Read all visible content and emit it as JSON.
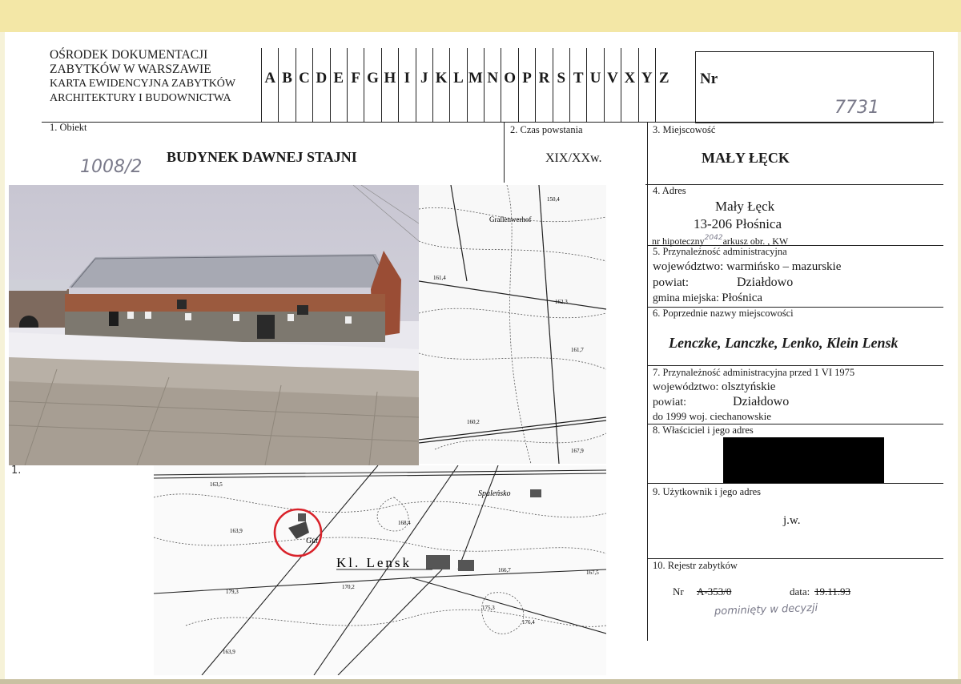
{
  "header": {
    "org_line1": "OŚRODEK DOKUMENTACJI",
    "org_line2": "ZABYTKÓW W WARSZAWIE",
    "org_line3": "KARTA EWIDENCYJNA ZABYTKÓW",
    "org_line4": "ARCHITEKTURY I BUDOWNICTWA",
    "letters": [
      "A",
      "B",
      "C",
      "D",
      "E",
      "F",
      "G",
      "H",
      "I",
      "J",
      "K",
      "L",
      "M",
      "N",
      "O",
      "P",
      "R",
      "S",
      "T",
      "U",
      "V",
      "X",
      "Y",
      "Z"
    ],
    "nr_label": "Nr",
    "nr_handwritten": "7731"
  },
  "sections": {
    "obiekt": {
      "label": "1. Obiekt",
      "value": "BUDYNEK DAWNEJ STAJNI",
      "handwritten": "1008/2"
    },
    "czas": {
      "label": "2. Czas powstania",
      "value": "XIX/XXw."
    },
    "miejscowosc": {
      "label": "3. Miejscowość",
      "value": "MAŁY ŁĘCK"
    },
    "adres": {
      "label": "4. Adres",
      "line1": "Mały Łęck",
      "line2": "13-206 Płośnica",
      "hipoteczny": "nr hipoteczny",
      "hipoteczny_hand": "2042",
      "arkusz": "arkusz   obr.   , KW"
    },
    "przynaleznosc": {
      "label": "5. Przynależność administracyjna",
      "woj_label": "województwo:",
      "woj": "warmińsko – mazurskie",
      "powiat_label": "powiat:",
      "powiat": "Działdowo",
      "gmina_label": "gmina miejska:",
      "gmina": "Płośnica"
    },
    "poprzednie": {
      "label": "6. Poprzednie nazwy miejscowości",
      "value": "Lenczke, Lanczke, Lenko, Klein Lensk"
    },
    "przed1975": {
      "label": "7. Przynależność administracyjna przed 1 VI 1975",
      "woj_label": "województwo:",
      "woj": "olsztyńskie",
      "powiat_label": "powiat:",
      "powiat": "Działdowo",
      "note": "do 1999 woj. ciechanowskie"
    },
    "wlasciciel": {
      "label": "8. Właściciel i jego adres"
    },
    "uzytkownik": {
      "label": "9. Użytkownik i jego adres",
      "value": "j.w."
    },
    "rejestr": {
      "label": "10. Rejestr zabytków",
      "nr_label": "Nr",
      "nr_value": "A-353/0",
      "data_label": "data:",
      "data_value": "19.11.93",
      "handwritten": "pominięty w decyzji"
    }
  },
  "photo_caption": "1.",
  "map": {
    "place_label": "Kl. Lensk",
    "secondary_label": "Spaleńsko",
    "north_label": "Grallenwerhof",
    "gut_label": "Gut",
    "elevations": [
      "150,4",
      "161,4",
      "162,3",
      "161,7",
      "160,2",
      "167,9",
      "163,9",
      "168,4",
      "170,2",
      "166,7",
      "167,5",
      "175,3",
      "176,4",
      "179,3",
      "163,9",
      "163,5"
    ],
    "marker_color": "#d9222a"
  },
  "colors": {
    "redaction": "#000000",
    "handwriting": "#7a7a8a",
    "yellow_edge": "#f3e7a6"
  }
}
